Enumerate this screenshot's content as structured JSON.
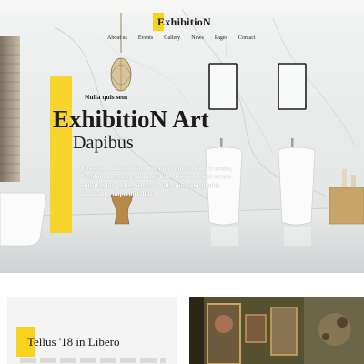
{
  "brand": {
    "name": "ExhibitioN",
    "accent": "#f7d31c"
  },
  "nav": {
    "items": [
      {
        "label": "About us"
      },
      {
        "label": "Events"
      },
      {
        "label": "Gallery"
      },
      {
        "label": "News"
      },
      {
        "label": "Pages"
      },
      {
        "label": "Contact"
      }
    ]
  },
  "hero": {
    "kicker": "Nulla quis sem",
    "title": "ExhibitioN Art",
    "subtitle": "Dapibus",
    "body": "Fusce nec tellus sed augue semper porta. Mauris massa, Vestibulum lacinia arcu eget nulla torquent, Sed cursus ante dapibus diam, Sed nisi. Nulla quis sem at nibh elementum imperdiet duis!"
  },
  "section": {
    "heading": "Tellus '18 in Libero"
  }
}
